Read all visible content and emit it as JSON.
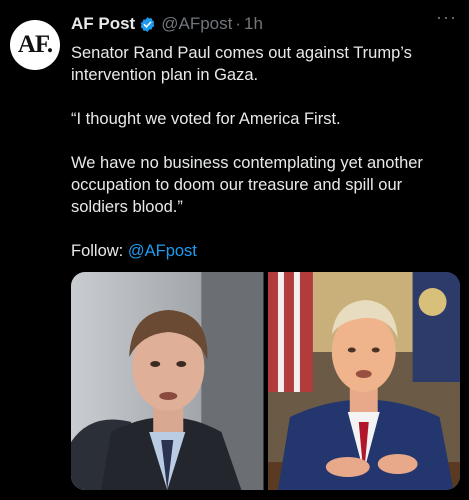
{
  "post": {
    "avatar_text": "AF.",
    "author_name": "AF Post",
    "handle": "@AFpost",
    "separator": "·",
    "time": "1h",
    "more_label": "···",
    "lines": [
      "Senator Rand Paul comes out against Trump’s intervention plan in Gaza.",
      "“I thought we voted for America First.",
      "We have no business contemplating yet another occupation to doom our treasure and spill our soldiers blood.”"
    ],
    "follow_label": "Follow: ",
    "follow_link": "@AFpost"
  },
  "colors": {
    "background": "#000000",
    "text": "#e7e9ea",
    "muted": "#71767b",
    "link": "#1d9bf0",
    "verified": "#1d9bf0"
  },
  "icons": {
    "verified": "verified-badge-icon",
    "more": "more-options-icon"
  }
}
